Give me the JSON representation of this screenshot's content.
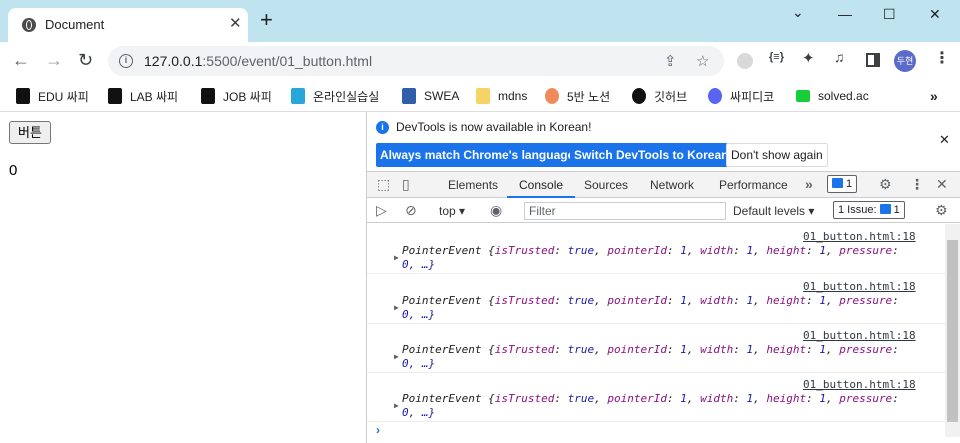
{
  "browser": {
    "tab_title": "Document",
    "new_tab": "+",
    "close_tab": "✕",
    "window_controls": {
      "minimize": "—",
      "maximize": "☐",
      "close": "✕",
      "menu": "⌄"
    },
    "url_host": "127.0.0.1",
    "url_rest": ":5500/event/01_button.html",
    "profile_initials": "두현"
  },
  "bookmarks": [
    {
      "label": "EDU 싸피",
      "icon_color": "#111111"
    },
    {
      "label": "LAB 싸피",
      "icon_color": "#111111"
    },
    {
      "label": "JOB 싸피",
      "icon_color": "#111111"
    },
    {
      "label": "온라인실습실",
      "icon_color": "#2aa7d9"
    },
    {
      "label": "SWEA",
      "icon_color": "#2f5fa8"
    },
    {
      "label": "mdns",
      "icon_color": "#f6d365"
    },
    {
      "label": "5반 노션",
      "icon_color": "#f08a5d"
    },
    {
      "label": "깃허브",
      "icon_color": "#111111"
    },
    {
      "label": "싸피디코",
      "icon_color": "#5865f2"
    },
    {
      "label": "solved.ac",
      "icon_color": "#17ce3a"
    }
  ],
  "page": {
    "button_label": "버튼",
    "counter_value": "0"
  },
  "devtools": {
    "banner_text": "DevTools is now available in Korean!",
    "btn_match": "Always match Chrome's language",
    "btn_switch": "Switch DevTools to Korean",
    "btn_dont_show": "Don't show again",
    "tabs": [
      "Elements",
      "Console",
      "Sources",
      "Network",
      "Performance"
    ],
    "active_tab": "Console",
    "messages_badge": "1",
    "context": "top",
    "filter_placeholder": "Filter",
    "levels": "Default levels",
    "issues": "1 Issue:",
    "issues_count": "1",
    "logs": [
      {
        "source": "01_button.html:18",
        "name": "PointerEvent",
        "line1_props": "{isTrusted: true, pointerId: 1, width: 1, height: 1, pressure:",
        "line2": "0, …}"
      },
      {
        "source": "01_button.html:18",
        "name": "PointerEvent",
        "line1_props": "{isTrusted: true, pointerId: 1, width: 1, height: 1, pressure:",
        "line2": "0, …}"
      },
      {
        "source": "01_button.html:18",
        "name": "PointerEvent",
        "line1_props": "{isTrusted: true, pointerId: 1, width: 1, height: 1, pressure:",
        "line2": "0, …}"
      },
      {
        "source": "01_button.html:18",
        "name": "PointerEvent",
        "line1_props": "{isTrusted: true, pointerId: 1, width: 1, height: 1, pressure:",
        "line2": "0, …}"
      }
    ]
  },
  "colors": {
    "accent": "#1a73e8",
    "titlebar": "#bfe3ef"
  }
}
